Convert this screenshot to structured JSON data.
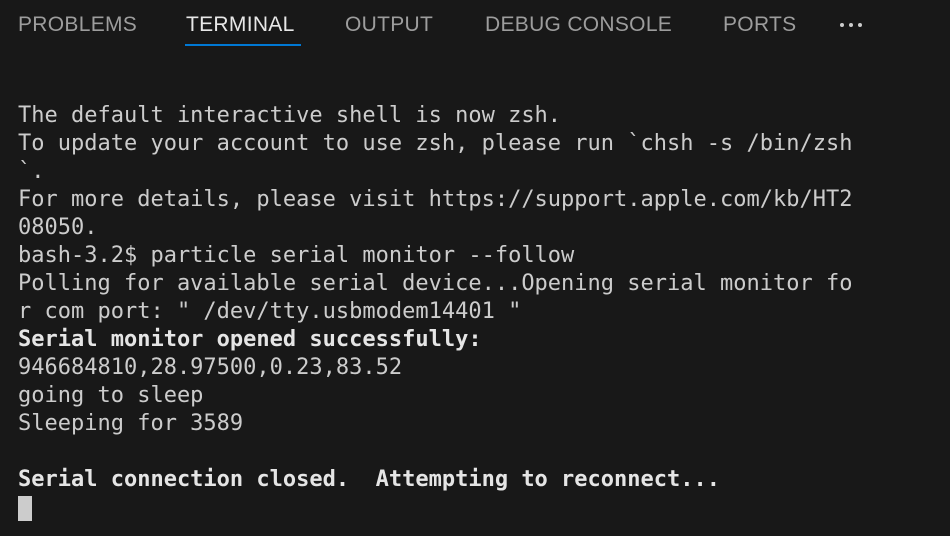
{
  "tabs": {
    "problems": "PROBLEMS",
    "terminal": "TERMINAL",
    "output": "OUTPUT",
    "debug_console": "DEBUG CONSOLE",
    "ports": "PORTS",
    "more_icon": "ellipsis-icon"
  },
  "active_tab": "TERMINAL",
  "terminal": {
    "lines": [
      "The default interactive shell is now zsh.",
      "To update your account to use zsh, please run `chsh -s /bin/zsh",
      "`.",
      "For more details, please visit https://support.apple.com/kb/HT2",
      "08050.",
      "bash-3.2$ particle serial monitor --follow",
      "Polling for available serial device...Opening serial monitor fo",
      "r com port: \" /dev/tty.usbmodem14401 \"",
      "Serial monitor opened successfully:",
      "946684810,28.97500,0.23,83.52",
      "going to sleep",
      "Sleeping for 3589",
      "",
      "Serial connection closed.  Attempting to reconnect..."
    ]
  },
  "colors": {
    "background": "#181818",
    "accent": "#0078d4",
    "text": "#cccccc"
  }
}
